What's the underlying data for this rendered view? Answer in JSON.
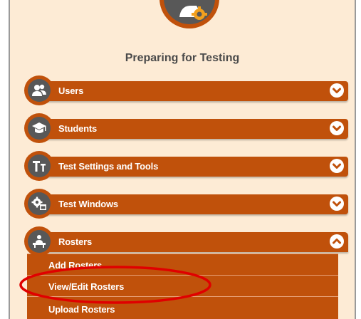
{
  "section": {
    "title": "Preparing for Testing"
  },
  "accordion": [
    {
      "label": "Users",
      "icon": "users-icon",
      "expanded": false
    },
    {
      "label": "Students",
      "icon": "graduation-cap-icon",
      "expanded": false
    },
    {
      "label": "Test Settings and Tools",
      "icon": "text-tools-icon",
      "expanded": false
    },
    {
      "label": "Test Windows",
      "icon": "calendar-gear-icon",
      "expanded": false
    },
    {
      "label": "Rosters",
      "icon": "presenter-icon",
      "expanded": true
    }
  ],
  "rosters_submenu": [
    {
      "label": "Add Rosters"
    },
    {
      "label": "View/Edit Rosters"
    },
    {
      "label": "Upload Rosters"
    }
  ],
  "colors": {
    "panel_bg": "#fdebd5",
    "accent": "#c0510b",
    "icon_bg": "#585858",
    "annotation": "#e00000"
  }
}
